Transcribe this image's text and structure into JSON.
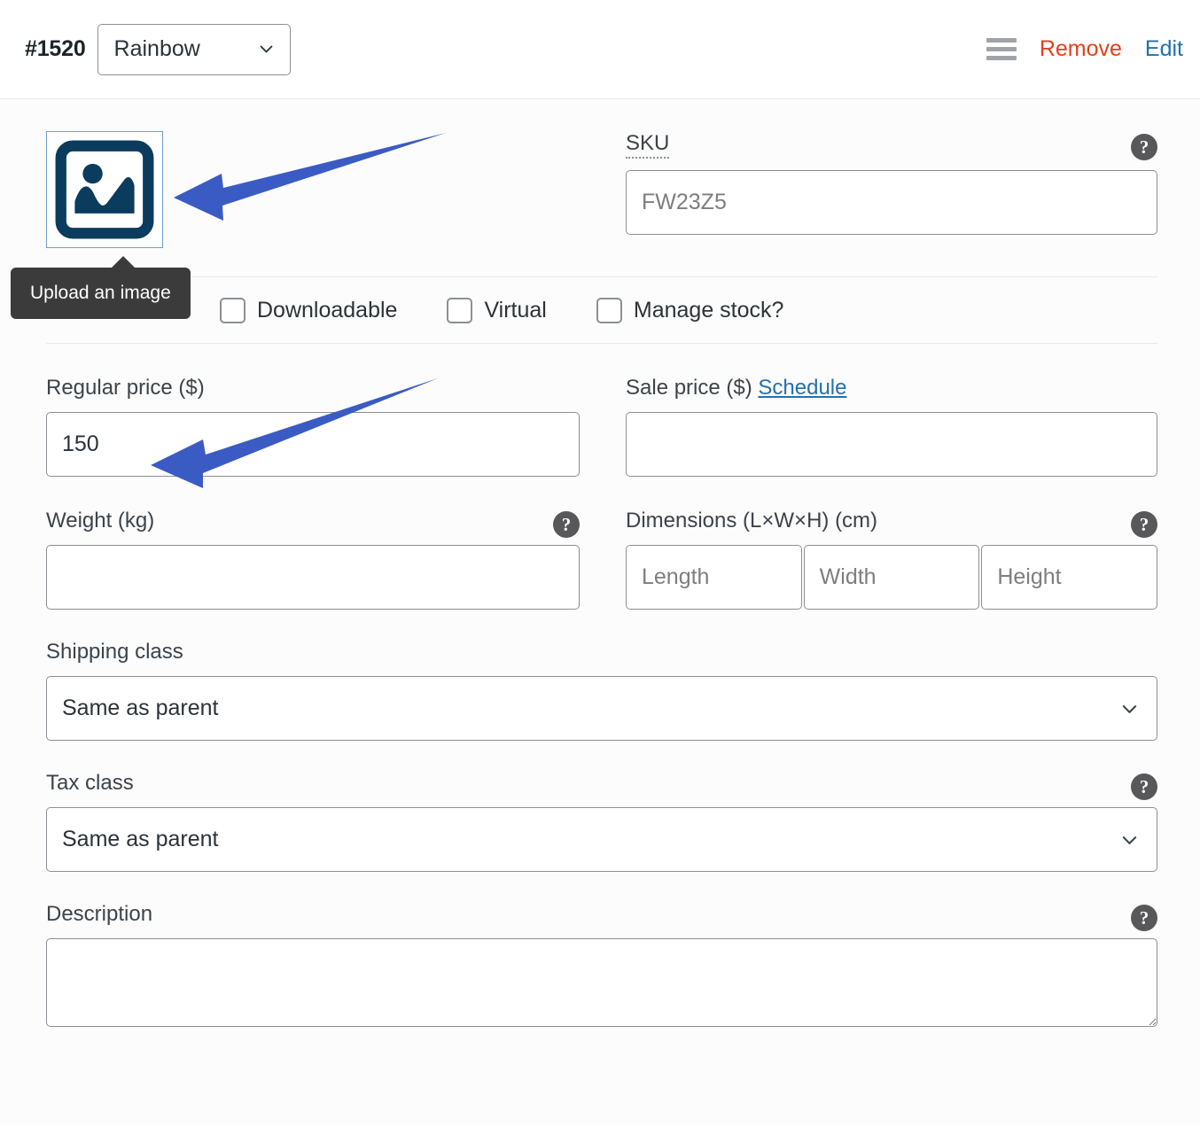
{
  "header": {
    "variation_id": "#1520",
    "attribute_value": "Rainbow",
    "attribute_chevron_icon": "chevron-down-icon",
    "drag_handle_icon": "hamburger-drag-icon",
    "remove_label": "Remove",
    "edit_label": "Edit",
    "remove_color": "#e2401c",
    "edit_color": "#2271b1"
  },
  "image": {
    "placeholder_icon": "image-placeholder-icon",
    "tooltip": "Upload an image",
    "tooltip_bg": "#3b3b3b",
    "border_color": "#6e9fcf"
  },
  "sku": {
    "label": "SKU",
    "value": "",
    "placeholder": "FW23Z5",
    "help_icon": "help-circle-icon"
  },
  "checkboxes": [
    {
      "label": "Downloadable",
      "checked": false
    },
    {
      "label": "Virtual",
      "checked": false
    },
    {
      "label": "Manage stock?",
      "checked": false
    }
  ],
  "pricing": {
    "regular_label": "Regular price ($)",
    "regular_value": "150",
    "regular_placeholder": "",
    "sale_label": "Sale price ($)",
    "sale_schedule_label": "Schedule",
    "sale_value": "",
    "sale_placeholder": ""
  },
  "shipping": {
    "weight_label": "Weight (kg)",
    "weight_value": "",
    "weight_placeholder": "",
    "weight_help_icon": "help-circle-icon",
    "dimensions_label": "Dimensions (L×W×H) (cm)",
    "dimensions_help_icon": "help-circle-icon",
    "length_placeholder": "Length",
    "length_value": "",
    "width_placeholder": "Width",
    "width_value": "",
    "height_placeholder": "Height",
    "height_value": "",
    "shipping_class_label": "Shipping class",
    "shipping_class_value": "Same as parent",
    "shipping_class_chevron_icon": "chevron-down-icon"
  },
  "tax": {
    "label": "Tax class",
    "value": "Same as parent",
    "help_icon": "help-circle-icon",
    "chevron_icon": "chevron-down-icon"
  },
  "description": {
    "label": "Description",
    "value": "",
    "placeholder": "",
    "help_icon": "help-circle-icon",
    "resize_handle_icon": "resize-handle-icon"
  },
  "annotations": {
    "arrow_color": "#3b5bc4",
    "arrow_1_target": "image-placeholder-icon",
    "arrow_2_target": "regular-price-input"
  }
}
